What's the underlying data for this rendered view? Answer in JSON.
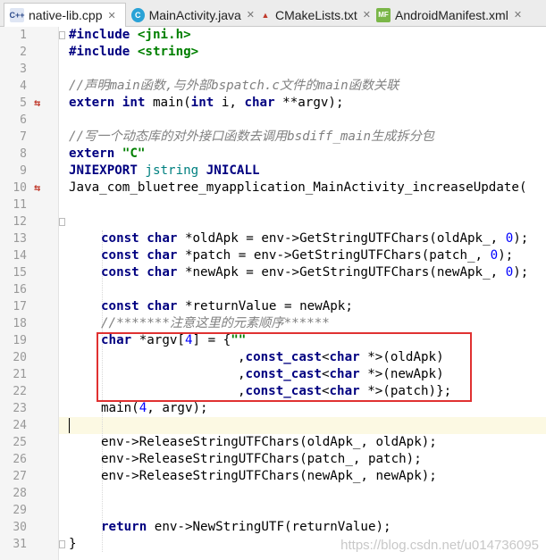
{
  "tabs": [
    {
      "label": "native-lib.cpp",
      "icon": "cpp-file-icon",
      "badge": "C++"
    },
    {
      "label": "MainActivity.java",
      "icon": "java-class-icon",
      "badge": "C"
    },
    {
      "label": "CMakeLists.txt",
      "icon": "cmake-file-icon",
      "badge": "▲"
    },
    {
      "label": "AndroidManifest.xml",
      "icon": "manifest-file-icon",
      "badge": "MF"
    }
  ],
  "editor": {
    "current_line": 24,
    "lines": [
      {
        "n": "1"
      },
      {
        "n": "2"
      },
      {
        "n": "3"
      },
      {
        "n": "4"
      },
      {
        "n": "5"
      },
      {
        "n": "6"
      },
      {
        "n": "7"
      },
      {
        "n": "8"
      },
      {
        "n": "9"
      },
      {
        "n": "10"
      },
      {
        "n": "11"
      },
      {
        "n": "12"
      },
      {
        "n": "13"
      },
      {
        "n": "14"
      },
      {
        "n": "15"
      },
      {
        "n": "16"
      },
      {
        "n": "17"
      },
      {
        "n": "18"
      },
      {
        "n": "19"
      },
      {
        "n": "20"
      },
      {
        "n": "21"
      },
      {
        "n": "22"
      },
      {
        "n": "23"
      },
      {
        "n": "24"
      },
      {
        "n": "25"
      },
      {
        "n": "26"
      },
      {
        "n": "27"
      },
      {
        "n": "28"
      },
      {
        "n": "29"
      },
      {
        "n": "30"
      },
      {
        "n": "31"
      }
    ],
    "code": {
      "l1_a": "#include ",
      "l1_b": "<jni.h>",
      "l2_a": "#include ",
      "l2_b": "<string>",
      "l4": "//声明main函数,与外部bspatch.c文件的main函数关联",
      "l5_a": "extern ",
      "l5_b": "int",
      "l5_c": " main(",
      "l5_d": "int",
      "l5_e": " i, ",
      "l5_f": "char",
      "l5_g": " **argv);",
      "l7": "//写一个动态库的对外接口函数去调用bsdiff_main生成拆分包",
      "l8_a": "extern ",
      "l8_b": "\"C\"",
      "l9_a": "JNIEXPORT ",
      "l9_b": "jstring ",
      "l9_c": "JNICALL",
      "l10": "Java_com_bluetree_myapplication_MainActivity_increaseUpdate(",
      "l13_a": "const ",
      "l13_b": "char",
      "l13_c": " *oldApk = env->GetStringUTFChars(oldApk_, ",
      "l13_d": "0",
      "l13_e": ");",
      "l14_a": "const ",
      "l14_b": "char",
      "l14_c": " *patch = env->GetStringUTFChars(patch_, ",
      "l14_d": "0",
      "l14_e": ");",
      "l15_a": "const ",
      "l15_b": "char",
      "l15_c": " *newApk = env->GetStringUTFChars(newApk_, ",
      "l15_d": "0",
      "l15_e": ");",
      "l17_a": "const ",
      "l17_b": "char",
      "l17_c": " *returnValue = newApk;",
      "l18": "//*******注意这里的元素顺序******",
      "l19_a": "char",
      "l19_b": " *argv[",
      "l19_c": "4",
      "l19_d": "] = {",
      "l19_e": "\"\"",
      "l20_a": ",",
      "l20_b": "const_cast",
      "l20_c": "<",
      "l20_d": "char",
      "l20_e": " *>(oldApk)",
      "l21_a": ",",
      "l21_b": "const_cast",
      "l21_c": "<",
      "l21_d": "char",
      "l21_e": " *>(newApk)",
      "l22_a": ",",
      "l22_b": "const_cast",
      "l22_c": "<",
      "l22_d": "char",
      "l22_e": " *>(patch)};",
      "l23_a": "main(",
      "l23_b": "4",
      "l23_c": ", argv);",
      "l25": "env->ReleaseStringUTFChars(oldApk_, oldApk);",
      "l26": "env->ReleaseStringUTFChars(patch_, patch);",
      "l27": "env->ReleaseStringUTFChars(newApk_, newApk);",
      "l30_a": "return",
      "l30_b": " env->NewStringUTF(returnValue);",
      "l31": "}"
    },
    "gutter_icons": [
      {
        "line": 5,
        "icon": "navigate-to-implementation-icon",
        "glyph": "⇆"
      },
      {
        "line": 10,
        "icon": "navigate-to-implementation-icon",
        "glyph": "⇆"
      }
    ]
  },
  "watermark": "https://blog.csdn.net/u014736095",
  "colors": {
    "keyword": "#000080",
    "string": "#008000",
    "number": "#0000ff",
    "comment": "#808080",
    "type": "#008080",
    "highlight_box": "#e03131",
    "current_line": "#fcf9e3"
  }
}
